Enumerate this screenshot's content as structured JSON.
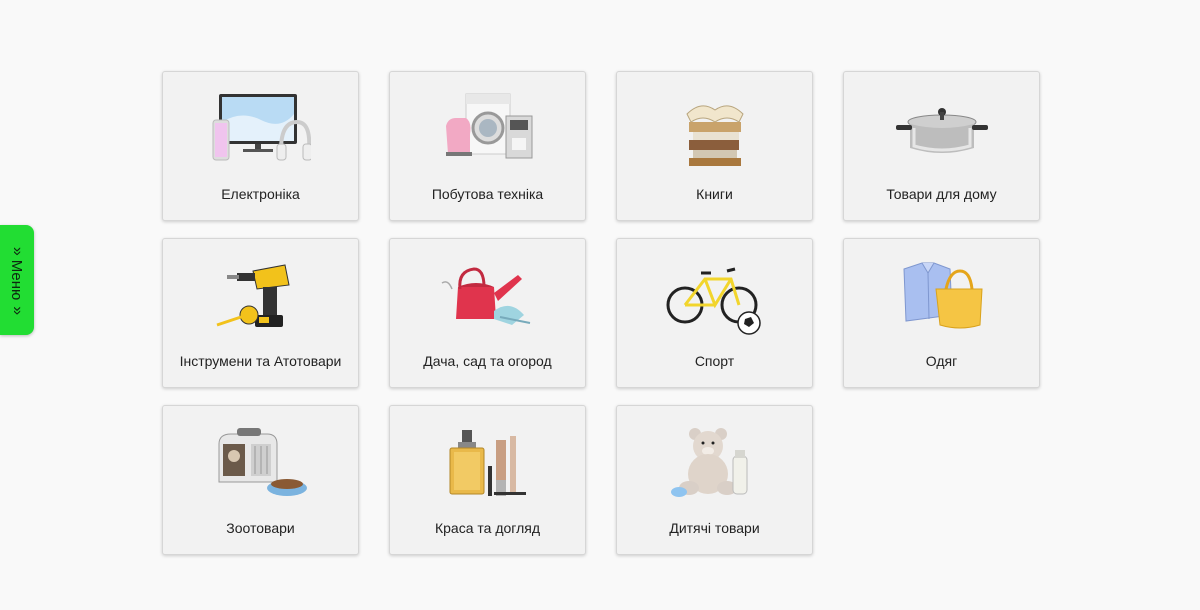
{
  "menu": {
    "label": "Меню"
  },
  "categories": [
    {
      "label": "Електроніка",
      "icon": "electronics-icon"
    },
    {
      "label": "Побутова техніка",
      "icon": "appliances-icon"
    },
    {
      "label": "Книги",
      "icon": "books-icon"
    },
    {
      "label": "Товари для дому",
      "icon": "cooking-pot-icon"
    },
    {
      "label": "Інструмени та Атотовари",
      "icon": "drill-icon"
    },
    {
      "label": "Дача, сад та огород",
      "icon": "watering-can-icon"
    },
    {
      "label": "Спорт",
      "icon": "bicycle-icon"
    },
    {
      "label": "Одяг",
      "icon": "clothing-icon"
    },
    {
      "label": "Зоотовари",
      "icon": "pet-carrier-icon"
    },
    {
      "label": "Краса та догляд",
      "icon": "perfume-icon"
    },
    {
      "label": "Дитячі товари",
      "icon": "teddy-bear-icon"
    }
  ]
}
